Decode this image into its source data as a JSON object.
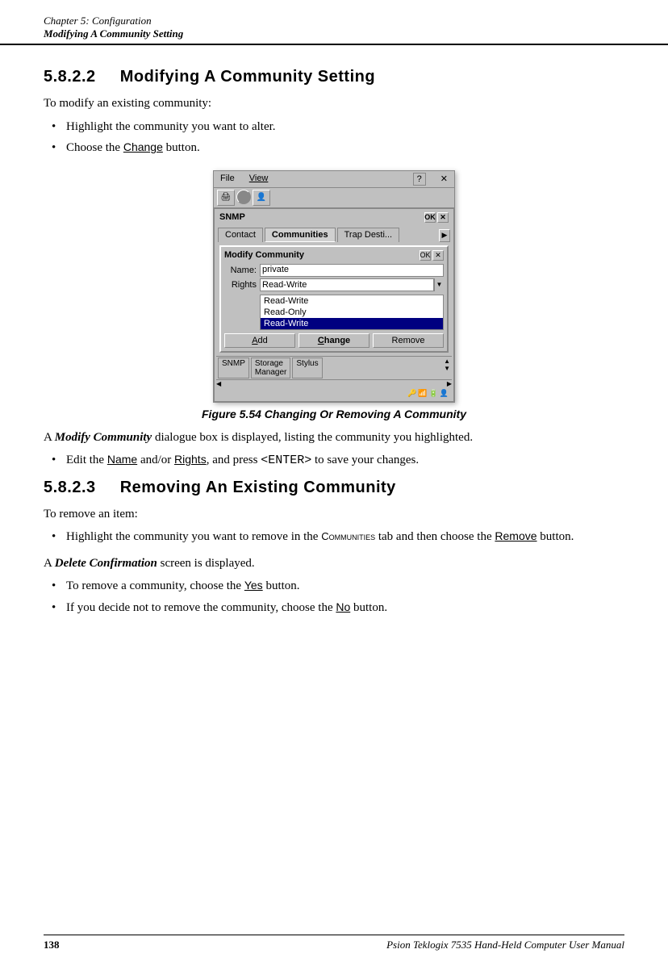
{
  "header": {
    "chapter_label": "Chapter  5:  Configuration",
    "chapter_title": "Modifying A Community Setting"
  },
  "sections": [
    {
      "id": "5822",
      "number": "5.8.2.2",
      "title": "Modifying A Community Setting",
      "intro": "To modify an existing community:",
      "bullets": [
        "Highlight the community you want to alter.",
        "Choose the Change button."
      ],
      "figure": {
        "caption": "Figure  5.54  Changing  Or  Removing  A  Community"
      },
      "after_bullets": [
        {
          "type": "paragraph",
          "text_parts": [
            {
              "type": "text",
              "text": "A "
            },
            {
              "type": "italic",
              "text": "Modify Community"
            },
            {
              "type": "text",
              "text": " dialogue box is displayed, listing the community you highlighted."
            }
          ]
        }
      ],
      "after_figure_bullets": [
        "Edit the Name and/or Rights, and press <ENTER> to save your changes."
      ]
    },
    {
      "id": "5823",
      "number": "5.8.2.3",
      "title": "Removing An  Existing  Community",
      "intro": "To remove an item:",
      "bullets": [
        "Highlight the community you want to remove in the Communities tab and then choose the Remove button."
      ],
      "after_para": "A Delete Confirmation screen is displayed.",
      "final_bullets": [
        "To remove a community, choose the Yes button.",
        "If you decide not to remove the community, choose the No button."
      ]
    }
  ],
  "dialog": {
    "menubar": {
      "file": "File",
      "view": "View",
      "help": "?"
    },
    "snmp_title": "SNMP",
    "ok_label": "OK",
    "tabs": [
      "Contact",
      "Communities",
      "Trap Desti..."
    ],
    "modify_title": "Modify Community",
    "fields": {
      "name_label": "Name:",
      "name_value": "private",
      "rights_label": "Rights",
      "rights_value": "Read-Write"
    },
    "dropdown_items": [
      "Read-Write",
      "Read-Only",
      "Read-Write"
    ],
    "buttons": {
      "add": "Add",
      "change": "Change",
      "remove": "Remove"
    },
    "taskbar_items": [
      "SNMP",
      "Storage Manager",
      "Stylus"
    ]
  },
  "footer": {
    "page_number": "138",
    "manual_title": "Psion Teklogix 7535 Hand-Held Computer User Manual"
  }
}
